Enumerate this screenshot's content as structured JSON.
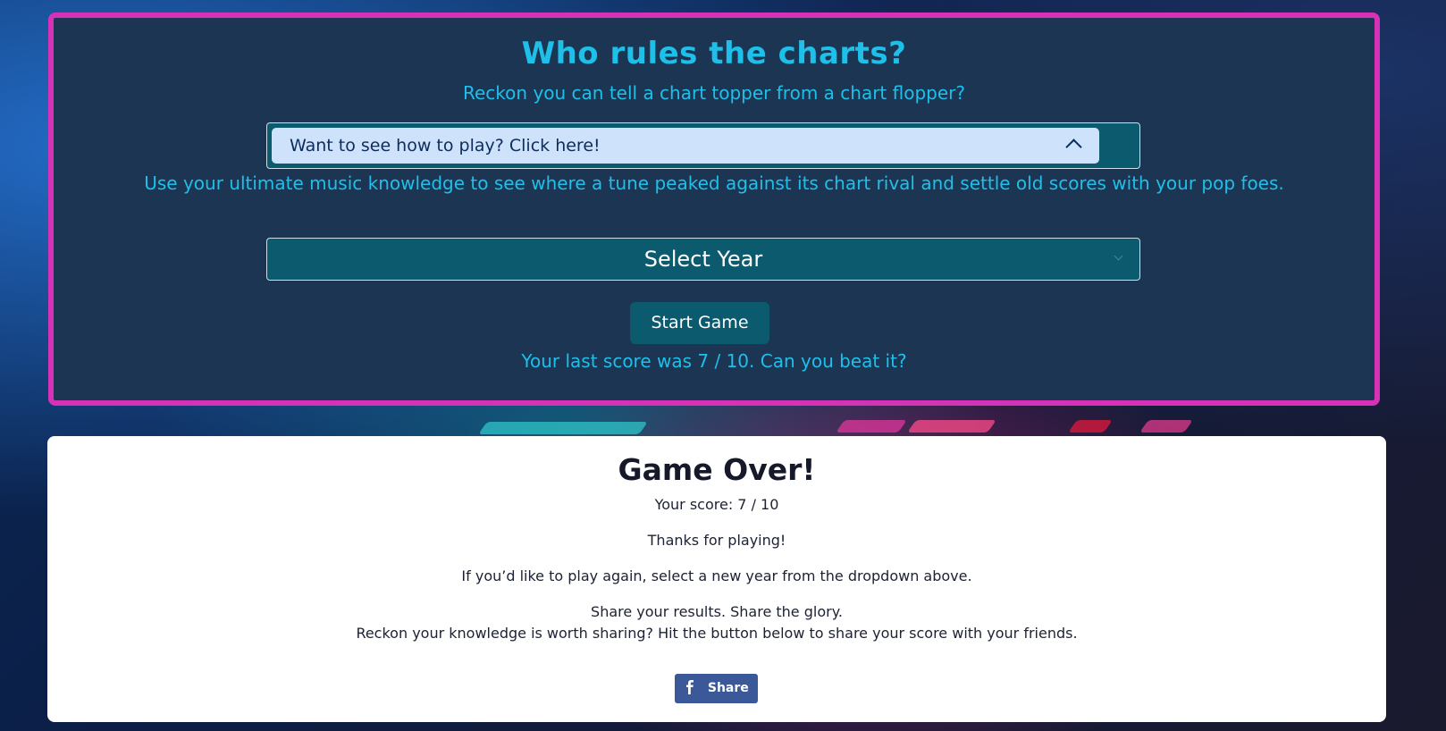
{
  "header": {
    "title": "Who rules the charts?",
    "subtitle": "Reckon you can tell a chart topper from a chart flopper?",
    "how_to_play_label": "Want to see how to play? Click here!",
    "description": "Use your ultimate music knowledge to see where a tune peaked against its chart rival and settle old scores with your pop foes.",
    "year_select": {
      "selected": "Select Year"
    },
    "start_button_label": "Start Game",
    "last_score_text": "Your last score was 7 / 10. Can you beat it?"
  },
  "game_over": {
    "title": "Game Over!",
    "score_text": "Your score: 7 / 10",
    "thanks_text": "Thanks for playing!",
    "play_again_text": "If you’d like to play again, select a new year from the dropdown above.",
    "share_heading": "Share your results. Share the glory.",
    "share_prompt": "Reckon your knowledge is worth sharing? Hit the button below to share your score with your friends.",
    "share_button_label": "Share",
    "share_icon": "facebook-icon"
  },
  "colors": {
    "panel_border": "#d632b8",
    "panel_bg": "#1b3553",
    "accent_text": "#1ec0ea",
    "button_bg": "#0b5a6e",
    "facebook_blue": "#3b5998"
  }
}
